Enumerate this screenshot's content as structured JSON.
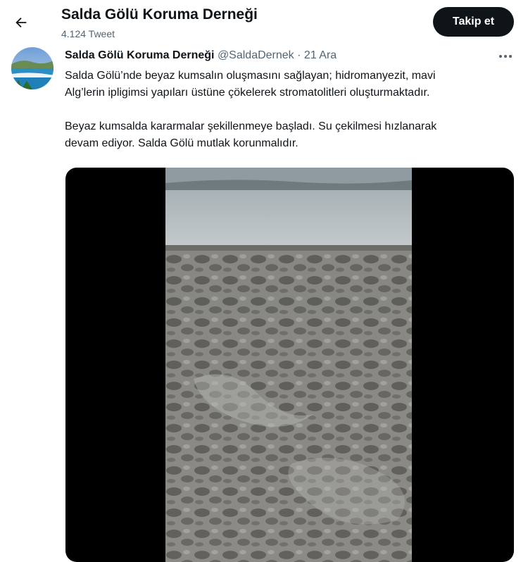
{
  "header": {
    "back_icon": "arrow-left-icon",
    "title": "Salda Gölü Koruma Derneği",
    "tweet_count": "4.124 Tweet",
    "follow_label": "Takip et"
  },
  "tweet": {
    "author_name": "Salda Gölü Koruma Derneği",
    "handle": "@SaldaDernek",
    "separator": "·",
    "date": "21 Ara",
    "more_icon": "more-horizontal-icon",
    "paragraph_1": "Salda Gölü’nde beyaz kumsalın oluşmasını sağlayan; hidromanyezit, mavi\nAlg’lerin ipligimsi yapıları üstüne çökelerek stromatolitleri oluşturmaktadır.",
    "paragraph_2": "Beyaz kumsalda kararmalar şekillenmeye başladı. Su çekilmesi hızlanarak\ndevam ediyor. Salda Gölü mutlak korunmalıdır."
  },
  "colors": {
    "text": "#0f1419",
    "secondary": "#536471",
    "follow_bg": "#0f1419",
    "media_bg": "#000000"
  }
}
